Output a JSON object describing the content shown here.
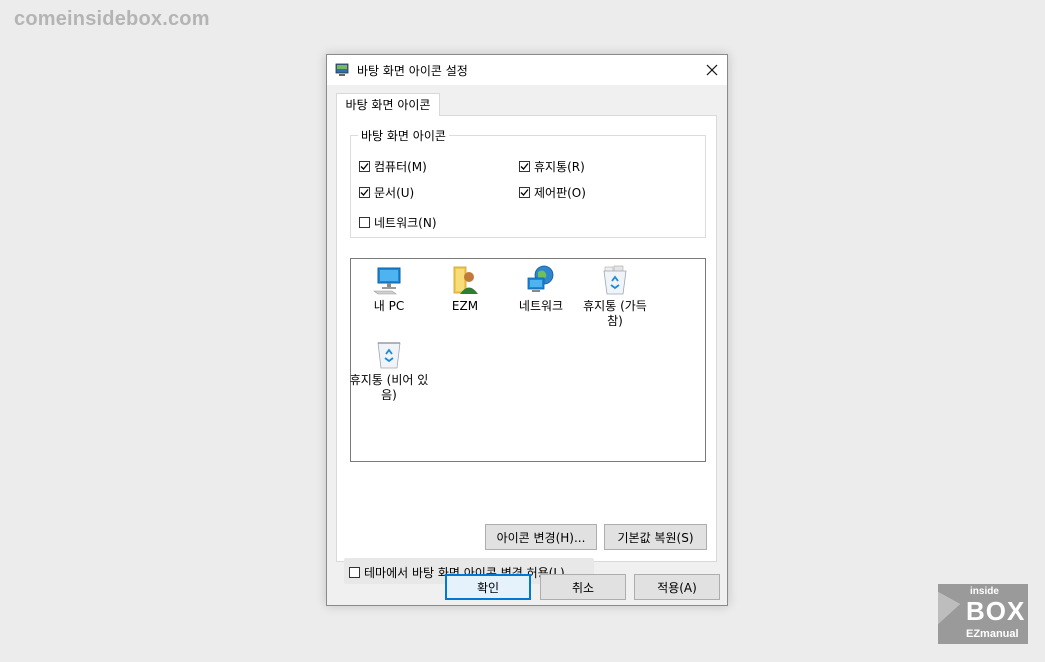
{
  "watermark": {
    "text": "comeinsidebox.com"
  },
  "logo": {
    "small": "inside",
    "big": "BOX",
    "sub": "EZmanual"
  },
  "dialog": {
    "title": "바탕 화면 아이콘 설정",
    "tab": "바탕 화면 아이콘",
    "group_label": "바탕 화면 아이콘",
    "checkboxes": [
      {
        "label": "컴퓨터(M)",
        "checked": true
      },
      {
        "label": "휴지통(R)",
        "checked": true
      },
      {
        "label": "문서(U)",
        "checked": true
      },
      {
        "label": "제어판(O)",
        "checked": true
      },
      {
        "label": "네트워크(N)",
        "checked": false
      }
    ],
    "icons": [
      {
        "label": "내 PC",
        "icon": "monitor-icon"
      },
      {
        "label": "EZM",
        "icon": "user-folder-icon"
      },
      {
        "label": "네트워크",
        "icon": "network-globe-icon"
      },
      {
        "label": "휴지통 (가득 참)",
        "icon": "recycle-bin-full-icon"
      },
      {
        "label": "휴지통 (비어 있음)",
        "icon": "recycle-bin-empty-icon"
      }
    ],
    "change_icon_button": "아이콘 변경(H)...",
    "restore_default_button": "기본값 복원(S)",
    "theme_checkbox": {
      "label": "테마에서 바탕 화면 아이콘 변경 허용(L)",
      "checked": false
    },
    "ok_button": "확인",
    "cancel_button": "취소",
    "apply_button": "적용(A)"
  },
  "colors": {
    "accent": "#0078d7",
    "background": "#ececec",
    "dialog": "#f0f0f0"
  }
}
